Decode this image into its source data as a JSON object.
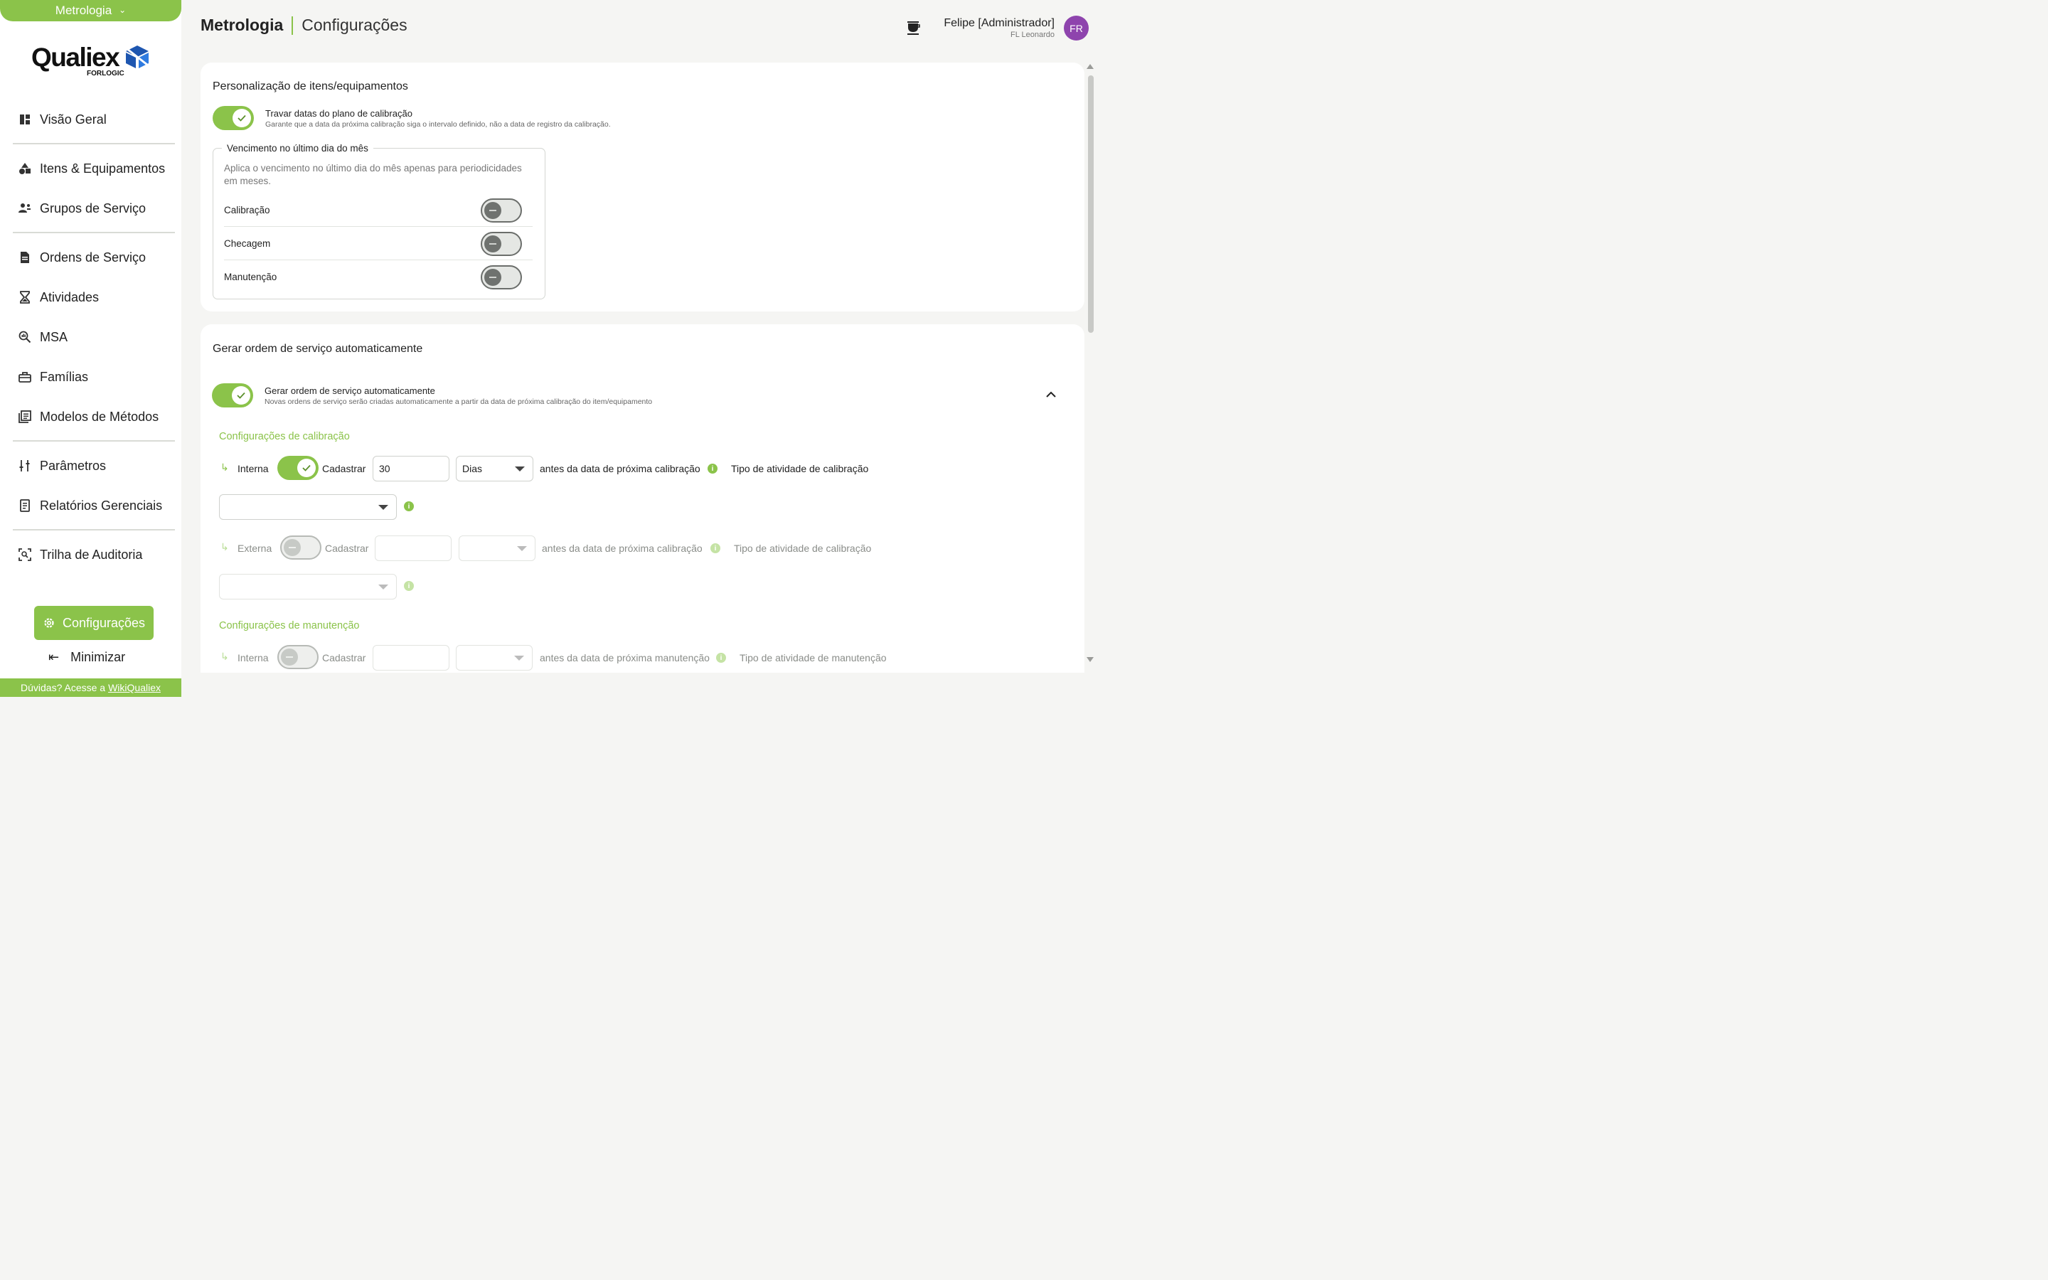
{
  "module": {
    "label": "Metrologia"
  },
  "brand": {
    "name": "Qualiex",
    "sub": "FORLOGIC"
  },
  "nav": {
    "items": [
      {
        "label": "Visão Geral",
        "icon": "dashboard-icon"
      },
      {
        "label": "Itens & Equipamentos",
        "icon": "shapes-icon"
      },
      {
        "label": "Grupos de Serviço",
        "icon": "group-icon"
      },
      {
        "label": "Ordens de Serviço",
        "icon": "document-icon"
      },
      {
        "label": "Atividades",
        "icon": "hourglass-icon"
      },
      {
        "label": "MSA",
        "icon": "analytics-search-icon"
      },
      {
        "label": "Famílias",
        "icon": "toolbox-icon"
      },
      {
        "label": "Modelos de Métodos",
        "icon": "library-icon"
      },
      {
        "label": "Parâmetros",
        "icon": "sliders-icon"
      },
      {
        "label": "Relatórios Gerenciais",
        "icon": "report-icon"
      },
      {
        "label": "Trilha de Auditoria",
        "icon": "audit-icon"
      }
    ],
    "config_label": "Configurações",
    "minimize_label": "Minimizar"
  },
  "help": {
    "prefix": "Dúvidas? Acesse a",
    "link": "WikiQualiex"
  },
  "header": {
    "module_title": "Metrologia",
    "page_title": "Configurações",
    "user_name": "Felipe [Administrador]",
    "user_org": "FL Leonardo",
    "avatar_initials": "FR",
    "avatar_color": "#8e44ad"
  },
  "colors": {
    "accent": "#8bc34a"
  },
  "card1": {
    "title": "Personalização de itens/equipamentos",
    "lock_toggle": {
      "on": true,
      "label": "Travar datas do plano de calibração",
      "desc": "Garante que a data da próxima calibração siga o intervalo definido, não a data de registro da calibração."
    },
    "due": {
      "legend": "Vencimento no último dia do mês",
      "desc": "Aplica o vencimento no último dia do mês apenas para periodicidades em meses.",
      "rows": [
        {
          "label": "Calibração",
          "on": false
        },
        {
          "label": "Checagem",
          "on": false
        },
        {
          "label": "Manutenção",
          "on": false
        }
      ]
    }
  },
  "card2": {
    "title": "Gerar ordem de serviço automaticamente",
    "auto_toggle": {
      "on": true,
      "label": "Gerar ordem de serviço automaticamente",
      "desc": "Novas ordens de serviço serão criadas automaticamente a partir da data de próxima calibração do item/equipamento"
    },
    "calibration": {
      "section": "Configurações de calibração",
      "internal": {
        "type": "Interna",
        "register_label": "Cadastrar",
        "register_on": true,
        "quantity": "30",
        "unit": "Dias",
        "before_text": "antes da data de próxima calibração",
        "activity_label": "Tipo de atividade de calibração",
        "activity_value": ""
      },
      "external": {
        "type": "Externa",
        "register_label": "Cadastrar",
        "register_on": false,
        "quantity": "",
        "unit": "",
        "before_text": "antes da data de próxima calibração",
        "activity_label": "Tipo de atividade de calibração",
        "activity_value": ""
      }
    },
    "maintenance": {
      "section": "Configurações de manutenção",
      "internal": {
        "type": "Interna",
        "register_label": "Cadastrar",
        "register_on": false,
        "quantity": "",
        "unit": "",
        "before_text": "antes da data de próxima manutenção",
        "activity_label": "Tipo de atividade de manutenção"
      }
    }
  }
}
